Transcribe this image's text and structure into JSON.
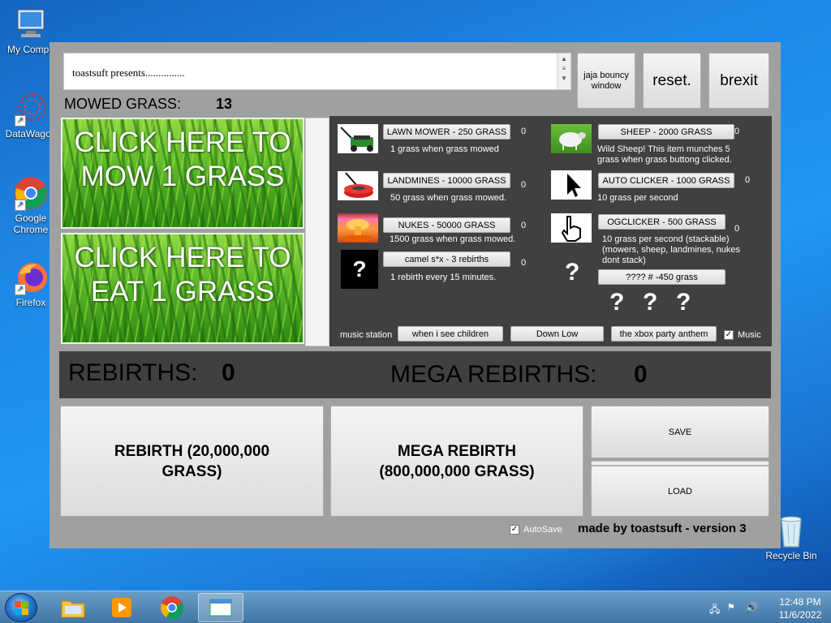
{
  "desktop": {
    "icons": [
      {
        "label": "My Compu"
      },
      {
        "label": "DataWagon"
      },
      {
        "label": "Google Chrome"
      },
      {
        "label": "Firefox"
      },
      {
        "label": "Recycle Bin"
      }
    ]
  },
  "game": {
    "log_text": "toastsuft presents...............",
    "top_buttons": {
      "bouncy": "jaja bouncy window",
      "reset": "reset.",
      "exit": "brexit"
    },
    "mowed_label": "MOWED GRASS:",
    "mowed_value": "13",
    "mow_button": "CLICK HERE TO MOW 1 GRASS",
    "eat_button": "CLICK HERE TO EAT 1 GRASS",
    "shop": {
      "left_items": [
        {
          "button": "LAWN MOWER - 250 GRASS",
          "count": "0",
          "desc": "1 grass when grass mowed",
          "icon": "lawn-mower"
        },
        {
          "button": "LANDMINES - 10000 GRASS",
          "count": "0",
          "desc": "50 grass when grass mowed.",
          "icon": "landmine"
        },
        {
          "button": "NUKES - 50000 GRASS",
          "count": "0",
          "desc": "1500 grass when grass mowed.",
          "icon": "explosion"
        },
        {
          "button": "camel s*x - 3 rebirths",
          "count": "0",
          "desc": "1 rebirth every 15 minutes.",
          "icon": "question"
        }
      ],
      "right_items": [
        {
          "button": "SHEEP - 2000 GRASS",
          "count": "0",
          "desc": "Wild Sheep! This item munches 5 grass when grass buttong clicked.",
          "icon": "sheep"
        },
        {
          "button": "AUTO CLICKER - 1000 GRASS",
          "count": "0",
          "desc": "10 grass per second",
          "icon": "cursor-arrow"
        },
        {
          "button": "OGCLICKER - 500 GRASS",
          "count": "0",
          "desc": "10 grass per second (stackable) (mowers, sheep, landmines, nukes dont stack)",
          "icon": "hand-cursor"
        },
        {
          "button": "???? # -450 grass",
          "count": "",
          "desc": "",
          "icon": "question"
        }
      ],
      "question_marks": [
        "?",
        "?",
        "?"
      ],
      "music_label": "music station",
      "music_tracks": [
        "when i see children",
        "Down Low",
        "the xbox party anthem"
      ],
      "music_checkbox": "Music"
    },
    "rebirths_label": "REBIRTHS:",
    "rebirths_value": "0",
    "mega_label": "MEGA REBIRTHS:",
    "mega_value": "0",
    "rebirth_button": "REBIRTH (20,000,000 GRASS)",
    "mega_button": "MEGA REBIRTH (800,000,000 GRASS)",
    "save_button": "SAVE",
    "load_button": "LOAD",
    "autosave_label": "AutoSave",
    "credit": "made by toastsuft - version 3"
  },
  "taskbar": {
    "time": "12:48 PM",
    "date": "11/6/2022"
  }
}
